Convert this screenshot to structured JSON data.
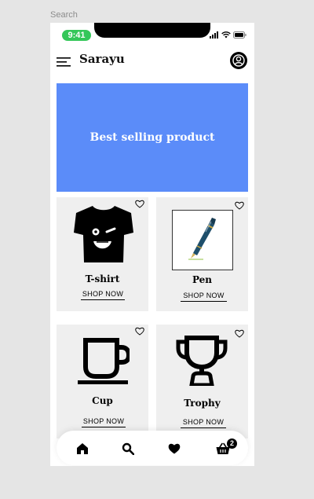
{
  "canvas": {
    "frame_label": "Search"
  },
  "status_bar": {
    "time": "9:41"
  },
  "header": {
    "app_title": "Sarayu"
  },
  "banner": {
    "text": "Best selling product",
    "color": "#5b8cf9"
  },
  "products": [
    {
      "name": "T-shirt",
      "action": "SHOP NOW",
      "icon": "tshirt-icon"
    },
    {
      "name": "Pen",
      "action": "SHOP NOW",
      "icon": "pen-icon"
    },
    {
      "name": "Cup",
      "action": "SHOP NOW",
      "icon": "cup-icon"
    },
    {
      "name": "Trophy",
      "action": "SHOP NOW",
      "icon": "trophy-icon"
    }
  ],
  "bottom_nav": {
    "items": [
      "home-icon",
      "search-icon",
      "heart-icon",
      "basket-icon"
    ],
    "cart_count": "2"
  },
  "colors": {
    "status_green": "#34c759",
    "card_bg": "#efefef"
  }
}
